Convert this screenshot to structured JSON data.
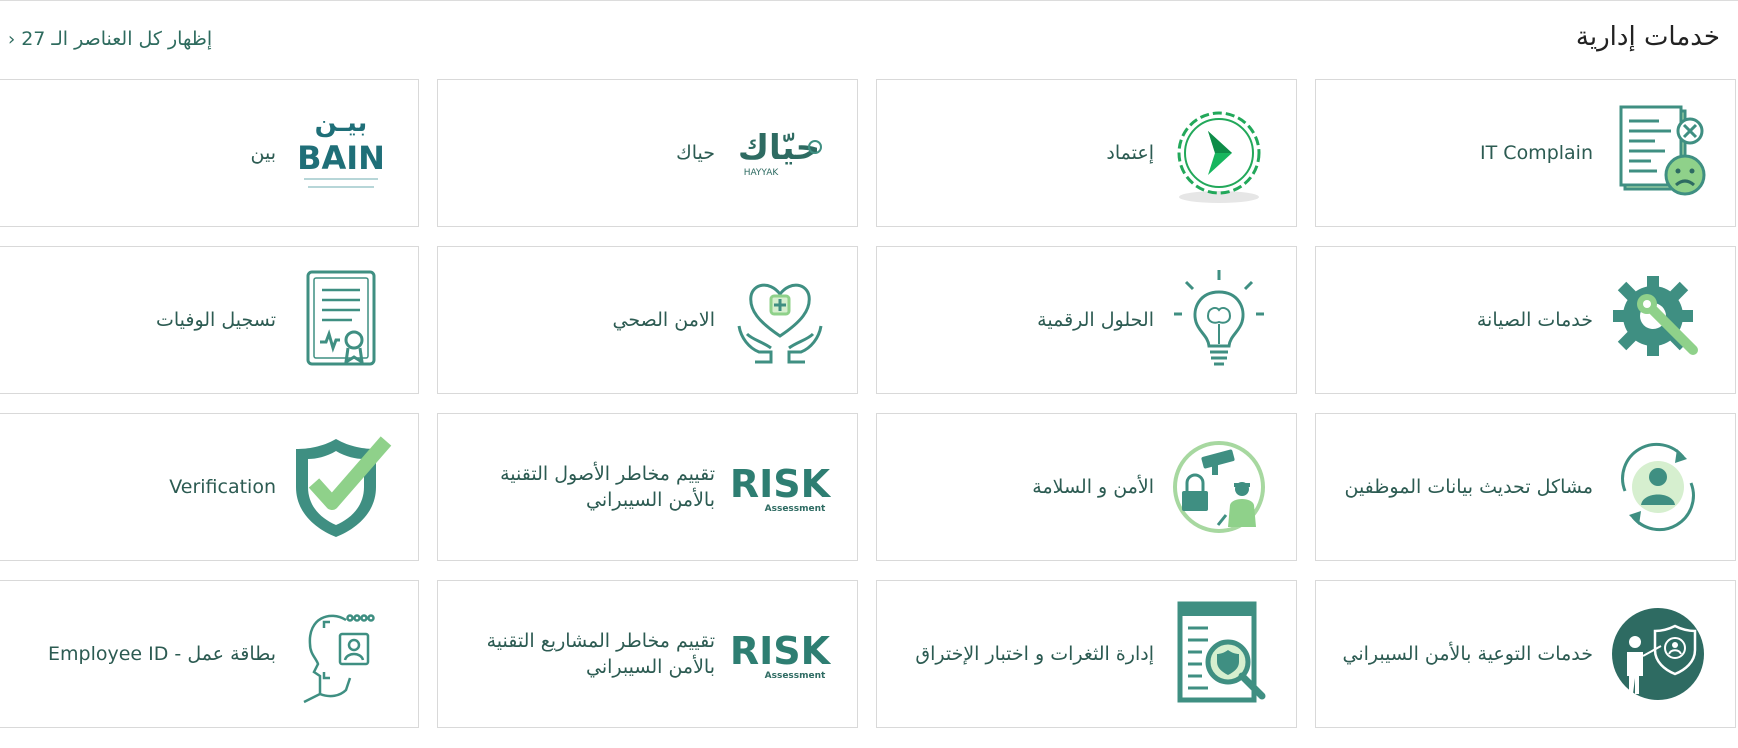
{
  "header": {
    "title": "خدمات إدارية",
    "show_all_label": "إظهار كل العناصر الـ 27"
  },
  "colors": {
    "teal": "#3f8f82",
    "dark_teal": "#2e6b62",
    "accent_green": "#8fd18a",
    "text": "#2c5b52"
  },
  "cards": [
    {
      "label": "IT Complain",
      "icon": "complaint-document-icon"
    },
    {
      "label": "إعتماد",
      "icon": "etimad-logo-icon"
    },
    {
      "label": "حياك",
      "icon": "hayyak-logo-icon",
      "logo_text": "حيّاك",
      "logo_subtext": "HAYYAK"
    },
    {
      "label": "بين",
      "icon": "bain-logo-icon",
      "logo_text": "بيـن",
      "logo_subtext": "BAIN"
    },
    {
      "label": "خدمات الصيانة",
      "icon": "gear-wrench-icon"
    },
    {
      "label": "الحلول الرقمية",
      "icon": "lightbulb-brain-icon"
    },
    {
      "label": "الامن الصحي",
      "icon": "heart-hands-icon"
    },
    {
      "label": "تسجيل الوفيات",
      "icon": "certificate-icon"
    },
    {
      "label": "مشاكل تحديث بيانات الموظفين",
      "icon": "user-sync-icon"
    },
    {
      "label": "الأمن و السلامة",
      "icon": "security-camera-guard-icon"
    },
    {
      "label": "تقييم مخاطر الأصول التقنية بالأمن السيبراني",
      "icon": "risk-assessment-icon",
      "logo_text": "RISK",
      "logo_subtext": "Assessment"
    },
    {
      "label": "Verification",
      "icon": "shield-check-icon"
    },
    {
      "label": "خدمات التوعية بالأمن السيبراني",
      "icon": "presenter-shield-icon"
    },
    {
      "label": "إدارة الثغرات و اختبار الإختراق",
      "icon": "document-magnifier-icon"
    },
    {
      "label": "تقييم مخاطر المشاريع التقنية بالأمن السيبراني",
      "icon": "risk-assessment-icon",
      "logo_text": "RISK",
      "logo_subtext": "Assessment"
    },
    {
      "label": "Employee ID - بطاقة عمل",
      "icon": "employee-id-icon"
    }
  ]
}
